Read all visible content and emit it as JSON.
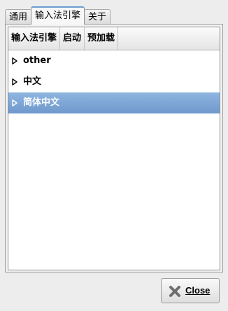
{
  "tabs": [
    {
      "label": "通用",
      "active": false
    },
    {
      "label": "输入法引擎",
      "active": true
    },
    {
      "label": "关于",
      "active": false
    }
  ],
  "tree": {
    "columns": [
      "输入法引擎",
      "启动",
      "预加载"
    ],
    "rows": [
      {
        "label": "other",
        "selected": false,
        "expander": "collapsed-triangle-icon"
      },
      {
        "label": "中文",
        "selected": false,
        "expander": "collapsed-triangle-icon"
      },
      {
        "label": "简体中文",
        "selected": true,
        "expander": "collapsed-triangle-icon"
      }
    ]
  },
  "close_button": {
    "label": "Close",
    "icon": "close-icon"
  },
  "colors": {
    "selection": "#7fa7d6",
    "active_tab_accent": "#6a9ed0",
    "window_background": "#ededed",
    "close_icon": "#6e6e6e"
  }
}
